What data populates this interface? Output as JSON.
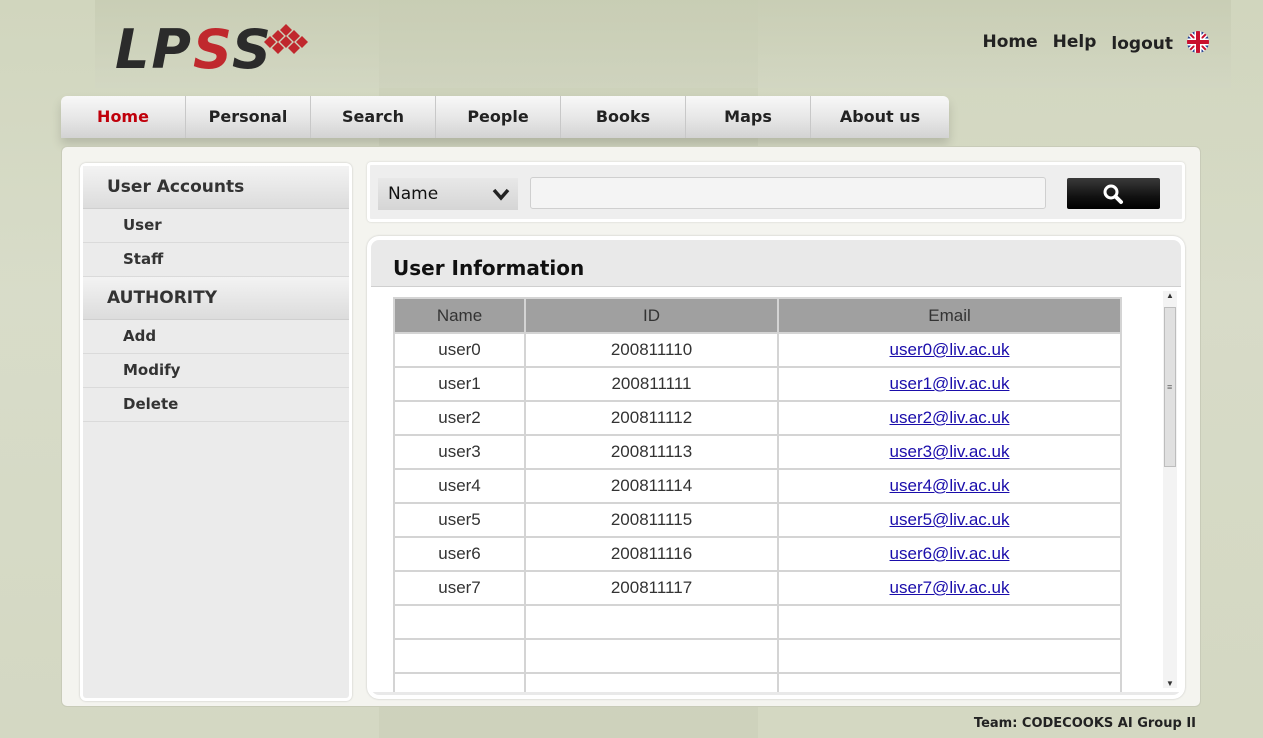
{
  "brand": {
    "logo_text_1": "LP",
    "logo_text_2": "S",
    "logo_text_3": "S"
  },
  "toplinks": {
    "home": "Home",
    "help": "Help",
    "logout": "logout"
  },
  "nav": [
    "Home",
    "Personal",
    "Search",
    "People",
    "Books",
    "Maps",
    "About us"
  ],
  "sidebar": {
    "section1": "User Accounts",
    "items1": [
      "User",
      "Staff"
    ],
    "section2": "AUTHORITY",
    "items2": [
      "Add",
      "Modify",
      "Delete"
    ]
  },
  "search": {
    "field_select": "Name",
    "query": ""
  },
  "panel": {
    "title": "User Information",
    "columns": [
      "Name",
      "ID",
      "Email"
    ],
    "rows": [
      [
        "user0",
        "200811110",
        "user0@liv.ac.uk"
      ],
      [
        "user1",
        "200811111",
        "user1@liv.ac.uk"
      ],
      [
        "user2",
        "200811112",
        "user2@liv.ac.uk"
      ],
      [
        "user3",
        "200811113",
        "user3@liv.ac.uk"
      ],
      [
        "user4",
        "200811114",
        "user4@liv.ac.uk"
      ],
      [
        "user5",
        "200811115",
        "user5@liv.ac.uk"
      ],
      [
        "user6",
        "200811116",
        "user6@liv.ac.uk"
      ],
      [
        "user7",
        "200811117",
        "user7@liv.ac.uk"
      ],
      [
        "",
        "",
        ""
      ],
      [
        "",
        "",
        ""
      ],
      [
        "",
        "",
        ""
      ]
    ]
  },
  "footer": {
    "team": "Team: CODECOOKS AI Group II"
  },
  "colors": {
    "accent": "#c0000b",
    "link": "#1a0dab"
  }
}
